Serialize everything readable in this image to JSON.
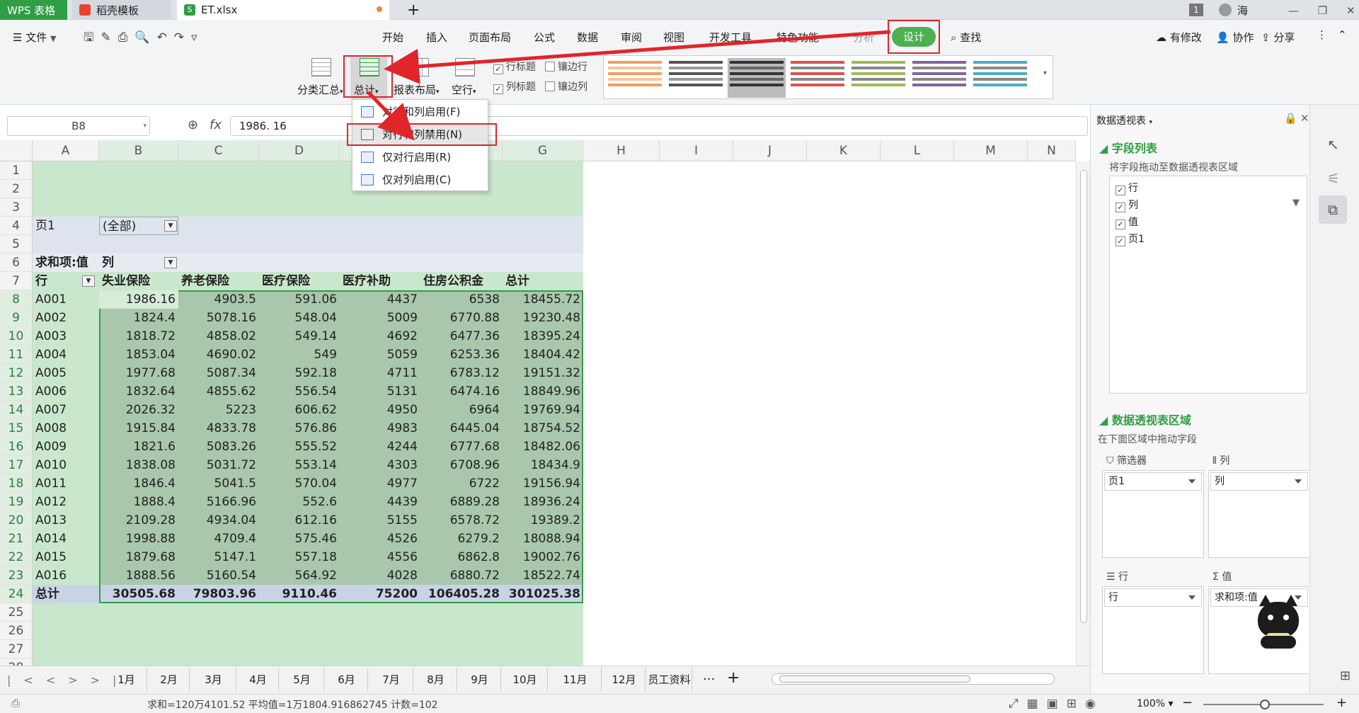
{
  "window": {
    "app_tab": "WPS 表格",
    "doc_tabs": [
      "稻壳模板",
      "ET.xlsx"
    ],
    "new_tab": "+",
    "user_badge": "1",
    "user_name": "海"
  },
  "quickbar": {
    "file_menu": "文件"
  },
  "ribbon_tabs": [
    "开始",
    "插入",
    "页面布局",
    "公式",
    "数据",
    "审阅",
    "视图",
    "开发工具",
    "特色功能",
    "分析",
    "设计"
  ],
  "ribbon_right": {
    "search": "查找",
    "modified": "有修改",
    "collab": "协作",
    "share": "分享"
  },
  "ribbon": {
    "subtotal": "分类汇总",
    "grandtotal": "总计",
    "report_layout": "报表布局",
    "blank_row": "空行",
    "row_header": "行标题",
    "banded_rows": "镶边行",
    "col_header": "列标题",
    "banded_cols": "镶边列"
  },
  "dropdown_menu": [
    "对行和列启用(F)",
    "对行和列禁用(N)",
    "仅对行启用(R)",
    "仅对列启用(C)"
  ],
  "formula_bar": {
    "name_box": "B8",
    "fx": "fx",
    "value": "1986. 16"
  },
  "columns": [
    "A",
    "B",
    "C",
    "D",
    "E",
    "F",
    "G",
    "H",
    "I",
    "J",
    "K",
    "L",
    "M",
    "N"
  ],
  "rows": [
    "1",
    "2",
    "3",
    "4",
    "5",
    "6",
    "7",
    "8",
    "9",
    "10",
    "11",
    "12",
    "13",
    "14",
    "15",
    "16",
    "17",
    "18",
    "19",
    "20",
    "21",
    "22",
    "23",
    "24",
    "25",
    "26",
    "27",
    "28"
  ],
  "pivot": {
    "page_label": "页1",
    "page_value": "(全部)",
    "sum_label": "求和项:值",
    "col_label": "列",
    "row_label": "行",
    "headers": [
      "失业保险",
      "养老保险",
      "医疗保险",
      "医疗补助",
      "住房公积金",
      "总计"
    ],
    "data": [
      [
        "A001",
        "1986.16",
        "4903.5",
        "591.06",
        "4437",
        "6538",
        "18455.72"
      ],
      [
        "A002",
        "1824.4",
        "5078.16",
        "548.04",
        "5009",
        "6770.88",
        "19230.48"
      ],
      [
        "A003",
        "1818.72",
        "4858.02",
        "549.14",
        "4692",
        "6477.36",
        "18395.24"
      ],
      [
        "A004",
        "1853.04",
        "4690.02",
        "549",
        "5059",
        "6253.36",
        "18404.42"
      ],
      [
        "A005",
        "1977.68",
        "5087.34",
        "592.18",
        "4711",
        "6783.12",
        "19151.32"
      ],
      [
        "A006",
        "1832.64",
        "4855.62",
        "556.54",
        "5131",
        "6474.16",
        "18849.96"
      ],
      [
        "A007",
        "2026.32",
        "5223",
        "606.62",
        "4950",
        "6964",
        "19769.94"
      ],
      [
        "A008",
        "1915.84",
        "4833.78",
        "576.86",
        "4983",
        "6445.04",
        "18754.52"
      ],
      [
        "A009",
        "1821.6",
        "5083.26",
        "555.52",
        "4244",
        "6777.68",
        "18482.06"
      ],
      [
        "A010",
        "1838.08",
        "5031.72",
        "553.14",
        "4303",
        "6708.96",
        "18434.9"
      ],
      [
        "A011",
        "1846.4",
        "5041.5",
        "570.04",
        "4977",
        "6722",
        "19156.94"
      ],
      [
        "A012",
        "1888.4",
        "5166.96",
        "552.6",
        "4439",
        "6889.28",
        "18936.24"
      ],
      [
        "A013",
        "2109.28",
        "4934.04",
        "612.16",
        "5155",
        "6578.72",
        "19389.2"
      ],
      [
        "A014",
        "1998.88",
        "4709.4",
        "575.46",
        "4526",
        "6279.2",
        "18088.94"
      ],
      [
        "A015",
        "1879.68",
        "5147.1",
        "557.18",
        "4556",
        "6862.8",
        "19002.76"
      ],
      [
        "A016",
        "1888.56",
        "5160.54",
        "564.92",
        "4028",
        "6880.72",
        "18522.74"
      ]
    ],
    "total": [
      "总计",
      "30505.68",
      "79803.96",
      "9110.46",
      "75200",
      "106405.28",
      "301025.38"
    ]
  },
  "sheet_tabs": [
    "1月",
    "2月",
    "3月",
    "4月",
    "5月",
    "6月",
    "7月",
    "8月",
    "9月",
    "10月",
    "11月",
    "12月",
    "员工资料"
  ],
  "status": {
    "summary": "求和=120万4101.52  平均值=1万1804.916862745  计数=102",
    "zoom": "100%"
  },
  "panel": {
    "title": "数据透视表",
    "field_list": "字段列表",
    "field_hint": "将字段拖动至数据透视表区域",
    "fields": [
      "行",
      "列",
      "值",
      "页1"
    ],
    "area_title": "数据透视表区域",
    "area_hint": "在下面区域中拖动字段",
    "filter_label": "筛选器",
    "col_label": "列",
    "row_label": "行",
    "value_label": "值",
    "filter_value": "页1",
    "col_value": "列",
    "row_value": "行",
    "value_value": "求和项:值"
  },
  "colors": {
    "green_sel": "#c9e7cc",
    "accent_green": "#4caf50",
    "red_annot": "#e0252b"
  }
}
